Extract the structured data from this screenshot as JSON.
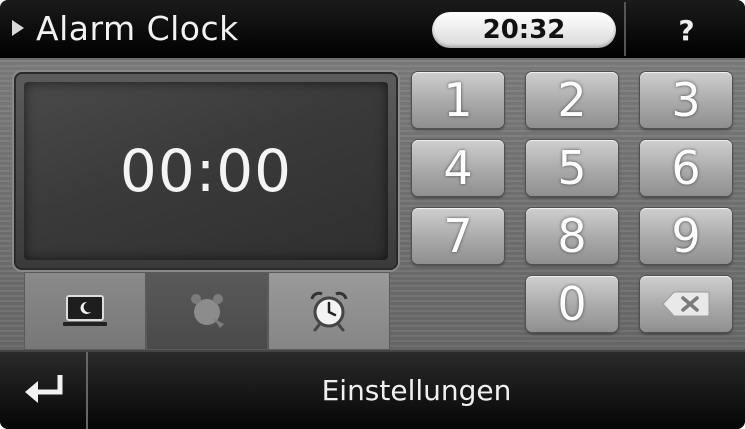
{
  "titlebar": {
    "title": "Alarm Clock",
    "time": "20:32",
    "help_label": "?"
  },
  "display": {
    "alarm_time": "00:00"
  },
  "keypad": {
    "keys": [
      "1",
      "2",
      "3",
      "4",
      "5",
      "6",
      "7",
      "8",
      "9",
      "0"
    ],
    "delete_icon": "backspace-icon"
  },
  "mode_tabs": [
    {
      "icon": "sleep-mode-icon",
      "active": false
    },
    {
      "icon": "snooze-alarm-icon",
      "active": true
    },
    {
      "icon": "alarm-clock-icon",
      "active": false
    }
  ],
  "bottombar": {
    "back_icon": "back-arrow-icon",
    "title": "Einstellungen"
  }
}
